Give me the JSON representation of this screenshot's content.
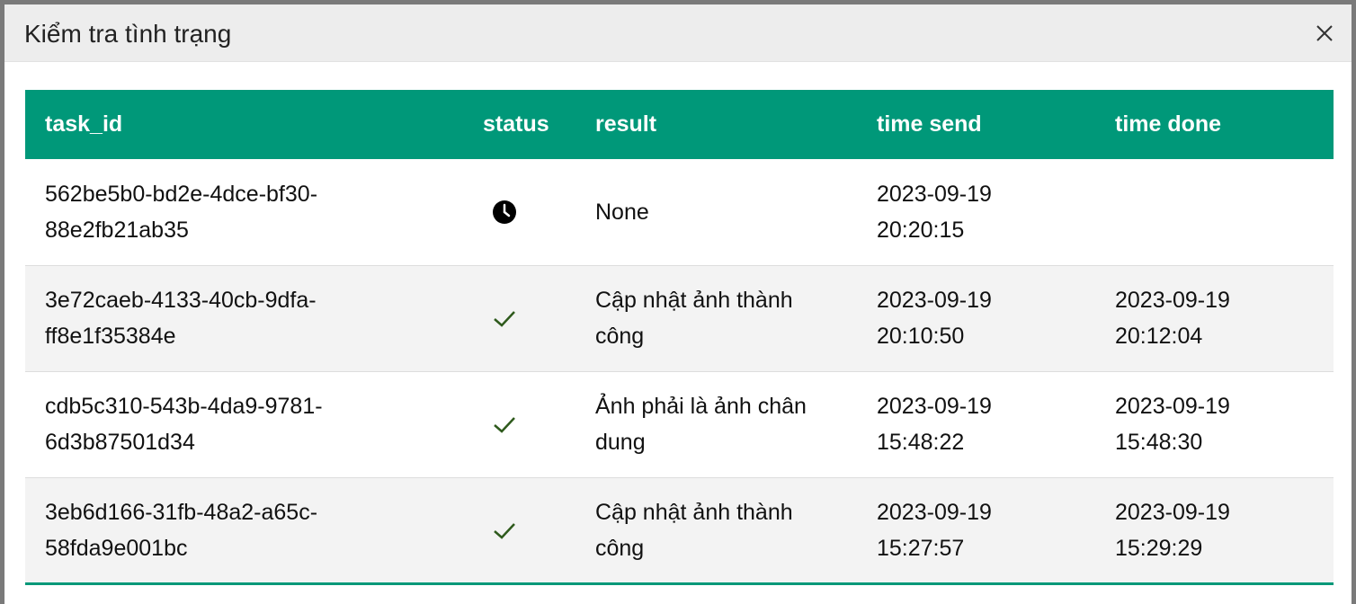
{
  "dialog": {
    "title": "Kiểm tra tình trạng",
    "close_icon": "close-icon"
  },
  "table": {
    "headers": {
      "task_id": "task_id",
      "status": "status",
      "result": "result",
      "time_send": "time send",
      "time_done": "time done"
    },
    "rows": [
      {
        "task_id": "562be5b0-bd2e-4dce-bf30-88e2fb21ab35",
        "status_icon": "clock-icon",
        "result": "None",
        "time_send": "2023-09-19 20:20:15",
        "time_done": ""
      },
      {
        "task_id": "3e72caeb-4133-40cb-9dfa-ff8e1f35384e",
        "status_icon": "check-icon",
        "result": "Cập nhật ảnh thành công",
        "time_send": "2023-09-19 20:10:50",
        "time_done": "2023-09-19 20:12:04"
      },
      {
        "task_id": "cdb5c310-543b-4da9-9781-6d3b87501d34",
        "status_icon": "check-icon",
        "result": "Ảnh phải là ảnh chân dung",
        "time_send": "2023-09-19 15:48:22",
        "time_done": "2023-09-19 15:48:30"
      },
      {
        "task_id": "3eb6d166-31fb-48a2-a65c-58fda9e001bc",
        "status_icon": "check-icon",
        "result": "Cập nhật ảnh thành công",
        "time_send": "2023-09-19 15:27:57",
        "time_done": "2023-09-19 15:29:29"
      }
    ]
  },
  "colors": {
    "header_bg": "#009879",
    "check_color": "#2e5a1c"
  }
}
